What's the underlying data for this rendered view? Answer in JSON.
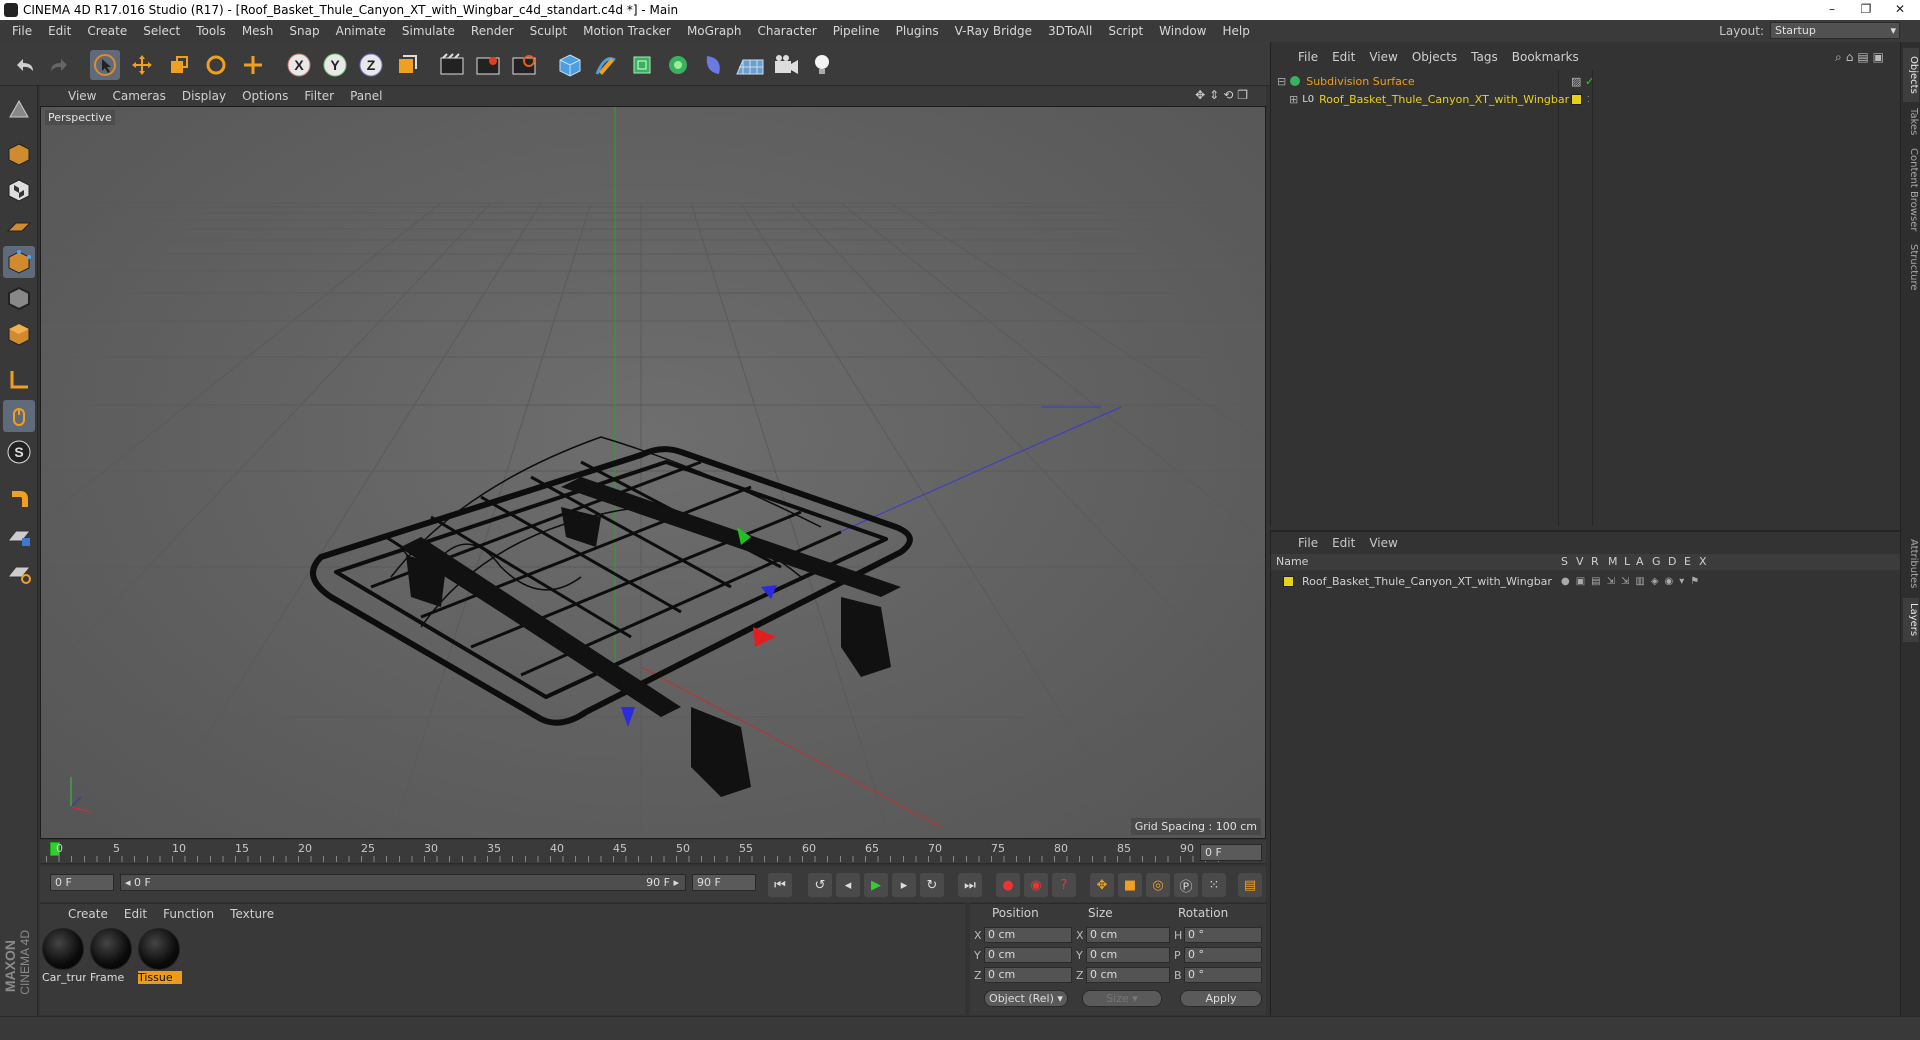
{
  "window": {
    "title": "CINEMA 4D R17.016 Studio (R17) - [Roof_Basket_Thule_Canyon_XT_with_Wingbar_c4d_standart.c4d *] - Main",
    "controls": [
      "–",
      "❐",
      "✕"
    ]
  },
  "menubar": {
    "items": [
      "File",
      "Edit",
      "Create",
      "Select",
      "Tools",
      "Mesh",
      "Snap",
      "Animate",
      "Simulate",
      "Render",
      "Sculpt",
      "Motion Tracker",
      "MoGraph",
      "Character",
      "Pipeline",
      "Plugins",
      "V-Ray Bridge",
      "3DToAll",
      "Script",
      "Window",
      "Help"
    ],
    "layout_label": "Layout:",
    "layout_value": "Startup"
  },
  "toolbar": {
    "axis_x": "X",
    "axis_y": "Y",
    "axis_z": "Z",
    "icons": [
      "undo-icon",
      "redo-icon",
      "select-icon",
      "move-icon",
      "scale-icon",
      "rotate-icon",
      "recent-tool-icon",
      "x-axis-icon",
      "y-axis-icon",
      "z-axis-icon",
      "world-coord-icon",
      "render-view-icon",
      "render-picture-icon",
      "render-settings-icon",
      "cube-icon",
      "pen-icon",
      "subdivision-icon",
      "cloner-icon",
      "deformer-icon",
      "floor-icon",
      "camera-icon",
      "light-icon"
    ]
  },
  "viewport": {
    "menu": [
      "View",
      "Cameras",
      "Display",
      "Options",
      "Filter",
      "Panel"
    ],
    "label": "Perspective",
    "grid_spacing": "Grid Spacing : 100 cm"
  },
  "timeline": {
    "ticks": [
      "0",
      "5",
      "10",
      "15",
      "20",
      "25",
      "30",
      "35",
      "40",
      "45",
      "50",
      "55",
      "60",
      "65",
      "70",
      "75",
      "80",
      "85",
      "90"
    ],
    "current_frame": "0 F"
  },
  "transport": {
    "start_field": "0 F",
    "range_start": "◂ 0 F",
    "range_end": "90 F ▸",
    "end_field": "90 F"
  },
  "materials": {
    "menu": [
      "Create",
      "Edit",
      "Function",
      "Texture"
    ],
    "items": [
      {
        "name": "Car_trur",
        "selected": false
      },
      {
        "name": "Frame",
        "selected": false
      },
      {
        "name": "Tissue",
        "selected": true
      }
    ]
  },
  "coordinates": {
    "headers": {
      "position": "Position",
      "size": "Size",
      "rotation": "Rotation"
    },
    "rows": [
      {
        "axis": "X",
        "pos": "0 cm",
        "size_axis": "X",
        "size": "0 cm",
        "rot_axis": "H",
        "rot": "0 °"
      },
      {
        "axis": "Y",
        "pos": "0 cm",
        "size_axis": "Y",
        "size": "0 cm",
        "rot_axis": "P",
        "rot": "0 °"
      },
      {
        "axis": "Z",
        "pos": "0 cm",
        "size_axis": "Z",
        "size": "0 cm",
        "rot_axis": "B",
        "rot": "0 °"
      }
    ],
    "mode": "Object (Rel)",
    "size_mode": "Size",
    "apply": "Apply"
  },
  "object_manager": {
    "menu": [
      "File",
      "Edit",
      "View",
      "Objects",
      "Tags",
      "Bookmarks"
    ],
    "objects": [
      {
        "name": "Subdivision Surface",
        "color": "#e8a020"
      },
      {
        "name": "Roof_Basket_Thule_Canyon_XT_with_Wingbar",
        "color": "#e8d11a"
      }
    ]
  },
  "layer_manager": {
    "menu": [
      "File",
      "Edit",
      "View"
    ],
    "col_name": "Name",
    "columns": [
      "S",
      "V",
      "R",
      "M",
      "L",
      "A",
      "G",
      "D",
      "E",
      "X"
    ],
    "layers": [
      {
        "name": "Roof_Basket_Thule_Canyon_XT_with_Wingbar",
        "color": "#e8d11a"
      }
    ]
  },
  "right_tabs": [
    "Objects",
    "Takes",
    "Content Browser",
    "Structure",
    "Attributes",
    "Layers"
  ],
  "branding": {
    "maxon": "MAXON",
    "product": "CINEMA 4D"
  }
}
